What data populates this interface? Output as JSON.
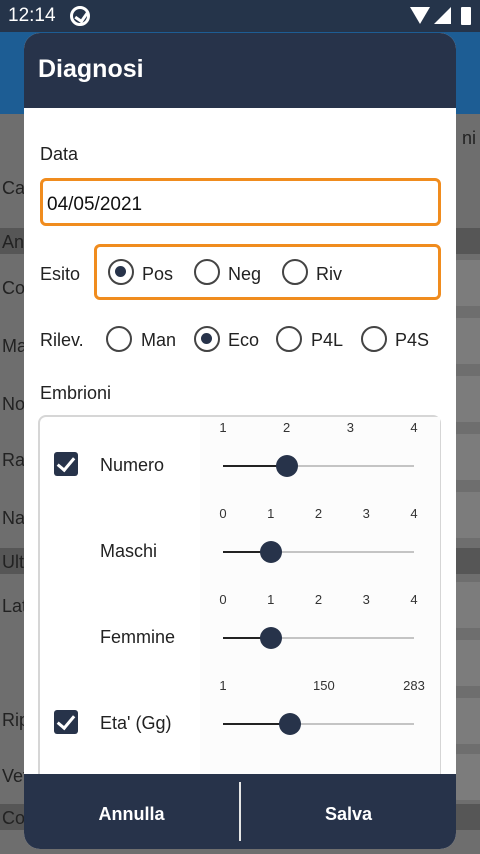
{
  "status_bar": {
    "time": "12:14"
  },
  "background": {
    "labels": [
      "Ca",
      "An",
      "Co",
      "Ma",
      "No",
      "Raz",
      "Na",
      "Ult",
      "Lat",
      "Rip",
      "Vet",
      "Co"
    ],
    "right_label": "ni"
  },
  "dialog": {
    "title": "Diagnosi",
    "date_label": "Data",
    "date_value": "04/05/2021",
    "esito": {
      "label": "Esito",
      "options": [
        "Pos",
        "Neg",
        "Riv"
      ],
      "selected": "Pos"
    },
    "rilev": {
      "label": "Rilev.",
      "options": [
        "Man",
        "Eco",
        "P4L",
        "P4S"
      ],
      "selected": "Eco"
    },
    "embrioni": {
      "label": "Embrioni",
      "rows": [
        {
          "label": "Numero",
          "checked": true,
          "ticks": [
            "1",
            "2",
            "3",
            "4"
          ],
          "min": 1,
          "max": 4,
          "value": 2
        },
        {
          "label": "Maschi",
          "checked": false,
          "ticks": [
            "0",
            "1",
            "2",
            "3",
            "4"
          ],
          "min": 0,
          "max": 4,
          "value": 1
        },
        {
          "label": "Femmine",
          "checked": false,
          "ticks": [
            "0",
            "1",
            "2",
            "3",
            "4"
          ],
          "min": 0,
          "max": 4,
          "value": 1
        },
        {
          "label": "Eta' (Gg)",
          "checked": true,
          "ticks": [
            "1",
            "150",
            "283"
          ],
          "min": 1,
          "max": 283,
          "value": 100
        }
      ]
    },
    "buttons": {
      "cancel": "Annulla",
      "save": "Salva"
    }
  },
  "colors": {
    "accent": "#f08c1e",
    "primary": "#27334a",
    "appbar": "#1d5d94"
  }
}
